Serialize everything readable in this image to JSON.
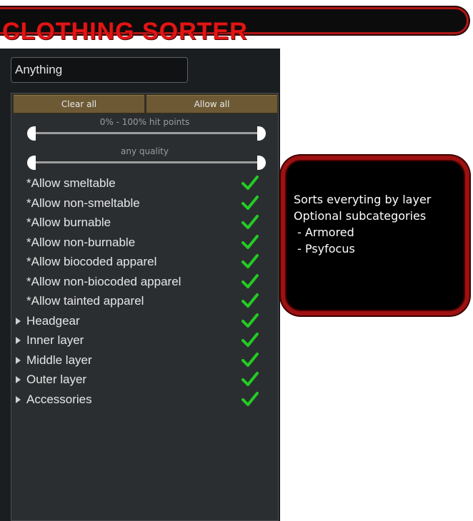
{
  "banner": {
    "title": "CLOTHING SORTER"
  },
  "filter": {
    "search_value": "Anything",
    "buttons": {
      "clear_all": "Clear all",
      "allow_all": "Allow all"
    },
    "sliders": {
      "hitpoints_label": "0% - 100% hit points",
      "hitpoints_range": [
        0,
        100
      ],
      "quality_label": "any quality"
    },
    "items": [
      {
        "label": "*Allow smeltable",
        "expandable": false,
        "checked": true
      },
      {
        "label": "*Allow non-smeltable",
        "expandable": false,
        "checked": true
      },
      {
        "label": "*Allow burnable",
        "expandable": false,
        "checked": true
      },
      {
        "label": "*Allow non-burnable",
        "expandable": false,
        "checked": true
      },
      {
        "label": "*Allow biocoded apparel",
        "expandable": false,
        "checked": true
      },
      {
        "label": "*Allow non-biocoded apparel",
        "expandable": false,
        "checked": true
      },
      {
        "label": "*Allow tainted apparel",
        "expandable": false,
        "checked": true
      },
      {
        "label": "Headgear",
        "expandable": true,
        "checked": true
      },
      {
        "label": "Inner layer",
        "expandable": true,
        "checked": true
      },
      {
        "label": "Middle layer",
        "expandable": true,
        "checked": true
      },
      {
        "label": "Outer layer",
        "expandable": true,
        "checked": true
      },
      {
        "label": "Accessories",
        "expandable": true,
        "checked": true
      }
    ],
    "icons": {
      "check": "check-icon",
      "expand": "triangle-right-icon"
    },
    "colors": {
      "check": "#22cc22",
      "button": "#6d5a35",
      "panel": "#2b2e31"
    }
  },
  "info": {
    "lines": [
      "Sorts everyting by layer",
      "Optional subcategories",
      " - Armored",
      " - Psyfocus"
    ],
    "colors": {
      "border": "#9e1111",
      "background": "#000000"
    }
  }
}
